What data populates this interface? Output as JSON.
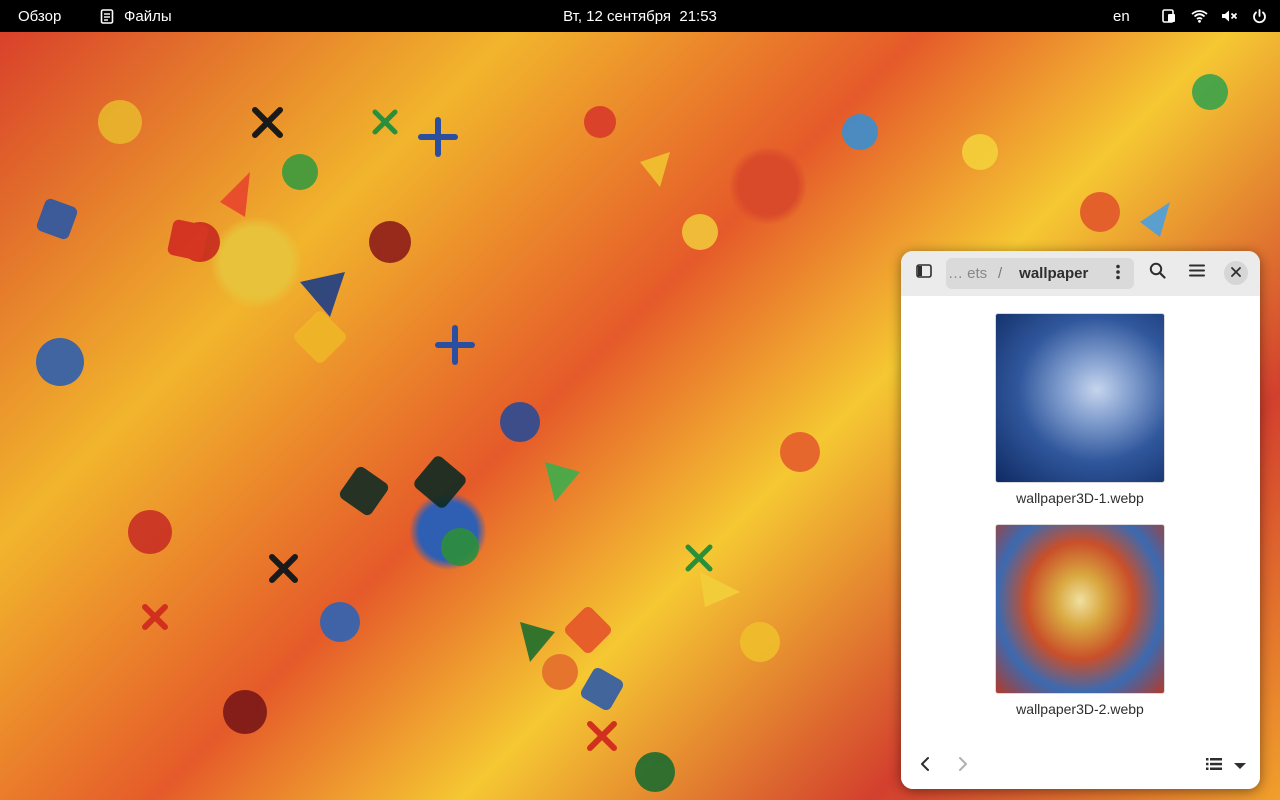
{
  "topbar": {
    "activities": "Обзор",
    "app_name": "Файлы",
    "app_icon": "files-app-icon",
    "clock": "Вт, 12 сентября  21:53",
    "language": "en",
    "status_icons": [
      "display-mirror-icon",
      "wifi-icon",
      "volume-muted-icon",
      "power-icon"
    ]
  },
  "file_manager": {
    "path": {
      "ellipsis": "… ets",
      "separator": "/",
      "current": "wallpaper"
    },
    "header_icons": [
      "sidebar-toggle-icon",
      "more-vertical-icon",
      "search-icon",
      "hamburger-menu-icon",
      "close-icon"
    ],
    "files": [
      {
        "name": "wallpaper3D-1.webp"
      },
      {
        "name": "wallpaper3D-2.webp"
      }
    ],
    "footer_icons": [
      "back-icon",
      "forward-icon",
      "list-view-icon",
      "chevron-down-icon"
    ]
  },
  "colors": {
    "topbar_bg": "#000000",
    "window_header_bg": "#ebebeb",
    "pathbar_bg": "#dadada",
    "window_bg": "#ffffff"
  }
}
